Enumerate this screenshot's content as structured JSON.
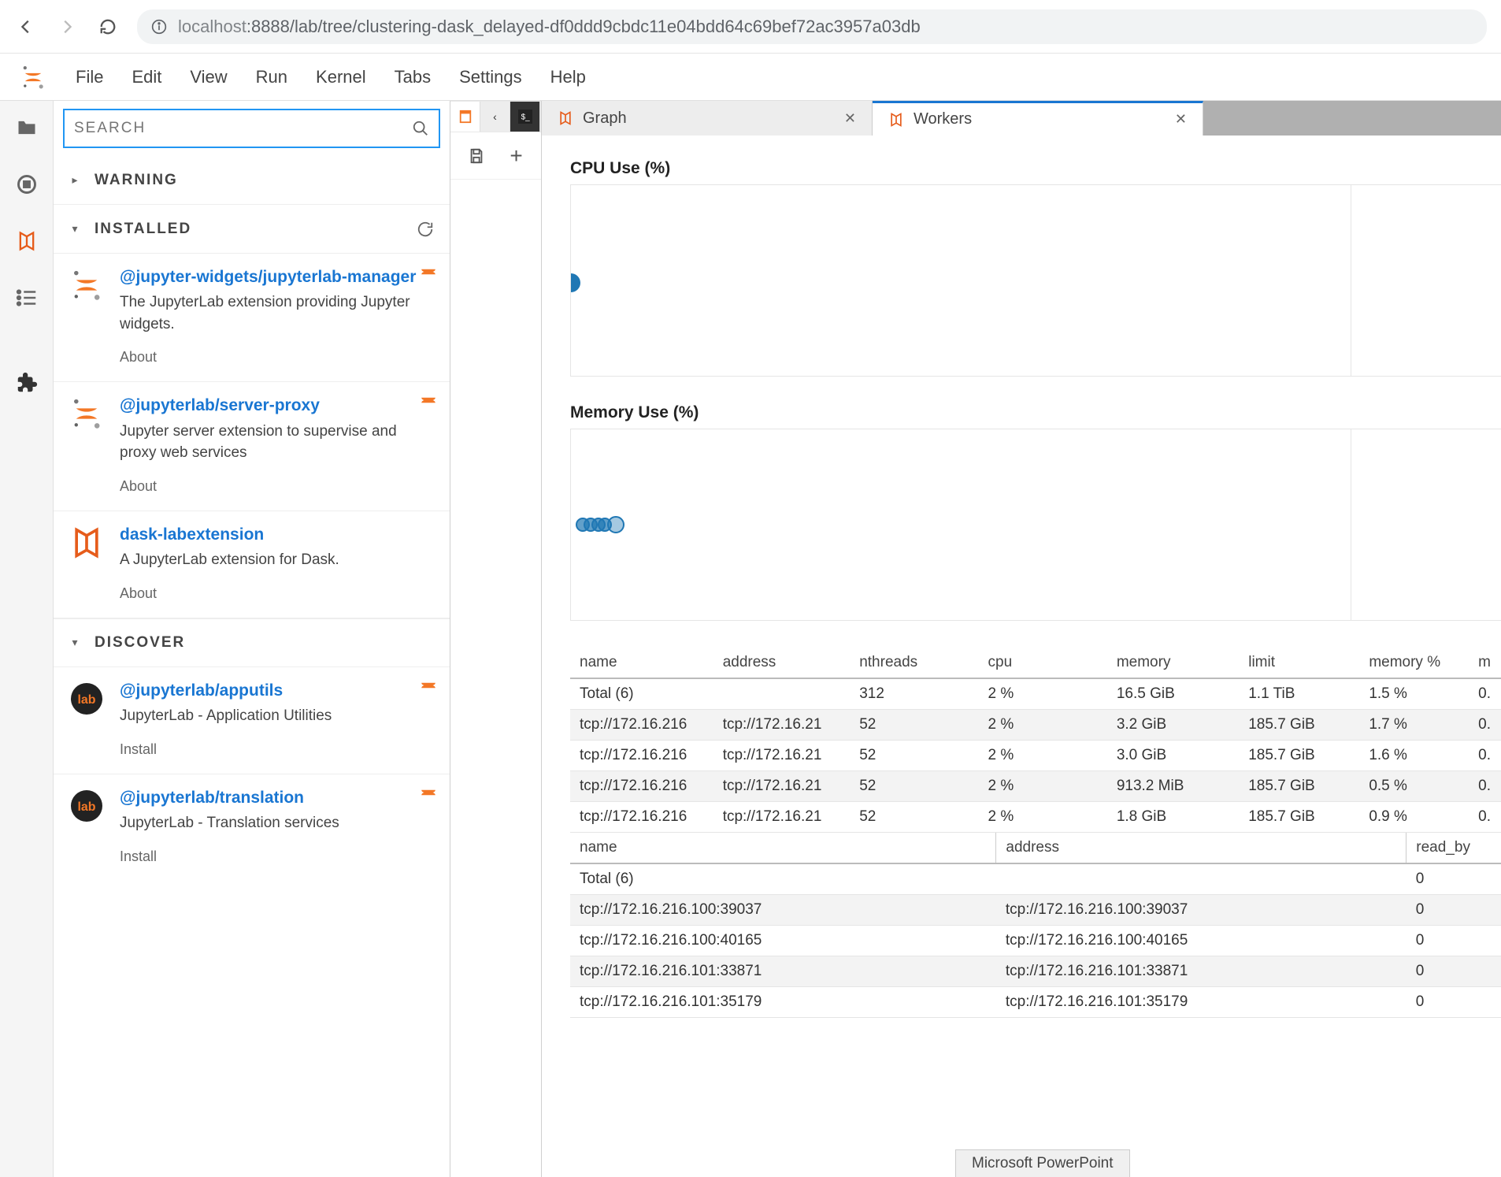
{
  "browser": {
    "url_host": "localhost",
    "url_port_path": ":8888/lab/tree/clustering-dask_delayed-df0ddd9cbdc11e04bdd64c69bef72ac3957a03db"
  },
  "menus": [
    "File",
    "Edit",
    "View",
    "Run",
    "Kernel",
    "Tabs",
    "Settings",
    "Help"
  ],
  "search_placeholder": "SEARCH",
  "sections": {
    "warning": "WARNING",
    "installed": "INSTALLED",
    "discover": "DISCOVER"
  },
  "installed": [
    {
      "name": "@jupyter-widgets/jupyterlab-manager",
      "desc": "The JupyterLab extension providing Jupyter widgets.",
      "action": "About",
      "icon": "jupyter"
    },
    {
      "name": "@jupyterlab/server-proxy",
      "desc": "Jupyter server extension to supervise and proxy web services",
      "action": "About",
      "icon": "jupyter"
    },
    {
      "name": "dask-labextension",
      "desc": "A JupyterLab extension for Dask.",
      "action": "About",
      "icon": "dask"
    }
  ],
  "discover": [
    {
      "name": "@jupyterlab/apputils",
      "desc": "JupyterLab - Application Utilities",
      "action": "Install",
      "icon": "lab"
    },
    {
      "name": "@jupyterlab/translation",
      "desc": "JupyterLab - Translation services",
      "action": "Install",
      "icon": "lab"
    }
  ],
  "tabs": {
    "graph": "Graph",
    "workers": "Workers"
  },
  "charts": {
    "cpu_title": "CPU Use (%)",
    "mem_title": "Memory Use (%)"
  },
  "chart_data": [
    {
      "type": "scatter",
      "title": "CPU Use (%)",
      "xlabel": "",
      "ylabel": "",
      "xlim": [
        0,
        100
      ],
      "series": [
        {
          "name": "workers",
          "x": [
            2
          ],
          "y": [
            0
          ]
        }
      ]
    },
    {
      "type": "scatter",
      "title": "Memory Use (%)",
      "xlabel": "",
      "ylabel": "",
      "xlim": [
        0,
        100
      ],
      "series": [
        {
          "name": "workers",
          "x": [
            0.5,
            0.9,
            1.5,
            1.6,
            1.7,
            2.2
          ],
          "y": [
            0,
            0,
            0,
            0,
            0,
            0
          ]
        }
      ]
    }
  ],
  "workers_table": {
    "columns": [
      "name",
      "address",
      "nthreads",
      "cpu",
      "memory",
      "limit",
      "memory %",
      "m"
    ],
    "rows": [
      {
        "name": "Total (6)",
        "address": "",
        "nthreads": "312",
        "cpu": "2 %",
        "memory": "16.5 GiB",
        "limit": "1.1 TiB",
        "memory_pct": "1.5 %",
        "m": "0.",
        "shade": false
      },
      {
        "name": "tcp://172.16.216",
        "address": "tcp://172.16.21",
        "nthreads": "52",
        "cpu": "2 %",
        "memory": "3.2 GiB",
        "limit": "185.7 GiB",
        "memory_pct": "1.7 %",
        "m": "0.",
        "shade": true
      },
      {
        "name": "tcp://172.16.216",
        "address": "tcp://172.16.21",
        "nthreads": "52",
        "cpu": "2 %",
        "memory": "3.0 GiB",
        "limit": "185.7 GiB",
        "memory_pct": "1.6 %",
        "m": "0.",
        "shade": false
      },
      {
        "name": "tcp://172.16.216",
        "address": "tcp://172.16.21",
        "nthreads": "52",
        "cpu": "2 %",
        "memory": "913.2 MiB",
        "limit": "185.7 GiB",
        "memory_pct": "0.5 %",
        "m": "0.",
        "shade": true
      },
      {
        "name": "tcp://172.16.216",
        "address": "tcp://172.16.21",
        "nthreads": "52",
        "cpu": "2 %",
        "memory": "1.8 GiB",
        "limit": "185.7 GiB",
        "memory_pct": "0.9 %",
        "m": "0.",
        "shade": false
      }
    ]
  },
  "streams_table": {
    "columns": [
      "name",
      "address",
      "read_by"
    ],
    "rows": [
      {
        "name": "Total (6)",
        "address": "",
        "read_by": "0",
        "shade": false
      },
      {
        "name": "tcp://172.16.216.100:39037",
        "address": "tcp://172.16.216.100:39037",
        "read_by": "0",
        "shade": true
      },
      {
        "name": "tcp://172.16.216.100:40165",
        "address": "tcp://172.16.216.100:40165",
        "read_by": "0",
        "shade": false
      },
      {
        "name": "tcp://172.16.216.101:33871",
        "address": "tcp://172.16.216.101:33871",
        "read_by": "0",
        "shade": true
      },
      {
        "name": "tcp://172.16.216.101:35179",
        "address": "tcp://172.16.216.101:35179",
        "read_by": "0",
        "shade": false
      }
    ]
  },
  "taskbar_hint": "Microsoft PowerPoint"
}
